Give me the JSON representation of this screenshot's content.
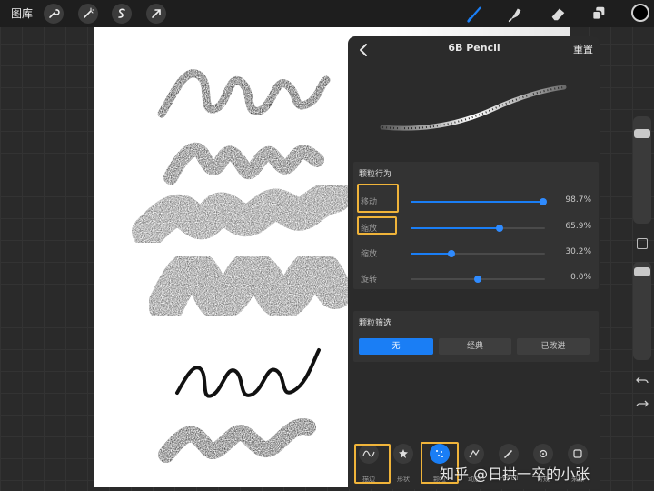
{
  "topbar": {
    "gallery_label": "图库",
    "icons": [
      "wrench-icon",
      "magic-wand-icon",
      "selection-icon",
      "transform-arrow-icon"
    ],
    "tools": [
      "brush-icon",
      "smudge-icon",
      "eraser-icon",
      "layers-icon"
    ],
    "active_tool": "brush-icon",
    "current_color": "#000000"
  },
  "brush_panel": {
    "title": "6B Pencil",
    "reset_label": "重置",
    "grain_behavior": {
      "title": "颗粒行为",
      "sliders": [
        {
          "label": "移动",
          "value": "98.7%",
          "fraction": 0.987,
          "highlighted": true
        },
        {
          "label": "缩放",
          "value": "65.9%",
          "fraction": 0.659,
          "highlighted": true
        },
        {
          "label": "缩放",
          "value": "30.2%",
          "fraction": 0.302,
          "highlighted": false
        },
        {
          "label": "旋转",
          "value": "0.0%",
          "fraction": 0.5,
          "highlighted": false
        }
      ]
    },
    "grain_filter": {
      "title": "颗粒筛选",
      "options": [
        "无",
        "经典",
        "已改进"
      ],
      "selected": "无"
    },
    "tabs": [
      {
        "label": "描边",
        "icon": "stroke-path-icon",
        "highlighted": true,
        "active": false
      },
      {
        "label": "形状",
        "icon": "shape-icon",
        "highlighted": false,
        "active": false
      },
      {
        "label": "颗粒",
        "icon": "grain-icon",
        "highlighted": true,
        "active": true
      },
      {
        "label": "动态",
        "icon": "dynamics-icon",
        "highlighted": false,
        "active": false
      },
      {
        "label": "Pencil",
        "icon": "pencil-icon",
        "highlighted": false,
        "active": false
      },
      {
        "label": "常规",
        "icon": "general-icon",
        "highlighted": false,
        "active": false
      },
      {
        "label": "来源",
        "icon": "source-icon",
        "highlighted": false,
        "active": false
      }
    ]
  },
  "watermark": "知乎 @日拱一卒的小张",
  "colors": {
    "accent": "#1a7ef5",
    "highlight": "#f0b43a",
    "panel": "#2b2b2b"
  }
}
